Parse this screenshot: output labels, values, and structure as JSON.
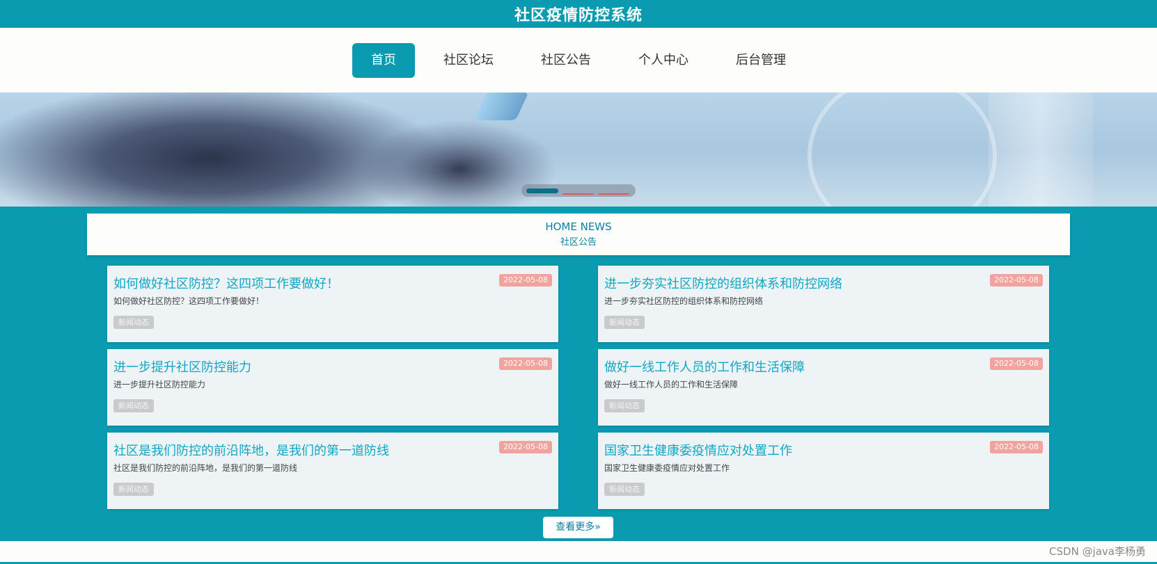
{
  "header": {
    "title": "社区疫情防控系统"
  },
  "nav": {
    "items": [
      {
        "label": "首页",
        "active": true
      },
      {
        "label": "社区论坛",
        "active": false
      },
      {
        "label": "社区公告",
        "active": false
      },
      {
        "label": "个人中心",
        "active": false
      },
      {
        "label": "后台管理",
        "active": false
      }
    ]
  },
  "carousel": {
    "slide_count": 3,
    "active_index": 0
  },
  "section": {
    "title_en": "HOME NEWS",
    "title_cn": "社区公告"
  },
  "news": [
    {
      "title": "如何做好社区防控？这四项工作要做好！",
      "date": "2022-05-08",
      "summary": "如何做好社区防控？这四项工作要做好！",
      "tag": "新闻动态"
    },
    {
      "title": "进一步夯实社区防控的组织体系和防控网络",
      "date": "2022-05-08",
      "summary": "进一步夯实社区防控的组织体系和防控网络",
      "tag": "新闻动态"
    },
    {
      "title": "进一步提升社区防控能力",
      "date": "2022-05-08",
      "summary": "进一步提升社区防控能力",
      "tag": "新闻动态"
    },
    {
      "title": "做好一线工作人员的工作和生活保障",
      "date": "2022-05-08",
      "summary": "做好一线工作人员的工作和生活保障",
      "tag": "新闻动态"
    },
    {
      "title": "社区是我们防控的前沿阵地，是我们的第一道防线",
      "date": "2022-05-08",
      "summary": "社区是我们防控的前沿阵地，是我们的第一道防线",
      "tag": "新闻动态"
    },
    {
      "title": "国家卫生健康委疫情应对处置工作",
      "date": "2022-05-08",
      "summary": "国家卫生健康委疫情应对处置工作",
      "tag": "新闻动态"
    }
  ],
  "more_button": {
    "label": "查看更多»"
  },
  "watermark": "CSDN @java李杨勇",
  "colors": {
    "primary": "#0b9bb0",
    "date_badge": "#f3a39d",
    "link": "#0fa7c5"
  }
}
